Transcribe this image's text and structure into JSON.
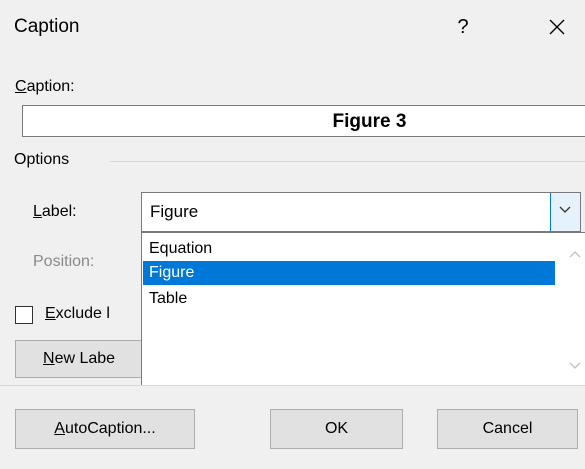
{
  "window": {
    "title": "Caption",
    "help_label": "?",
    "close_icon": "close-icon"
  },
  "caption": {
    "label_first": "C",
    "label_rest": "aption:",
    "value": "Figure 3"
  },
  "options": {
    "group_label": "Options",
    "label_field": {
      "label_first": "L",
      "label_rest": "abel:",
      "value": "Figure"
    },
    "position_field": {
      "label": "Position:"
    },
    "dropdown_items": [
      {
        "label": "Equation",
        "selected": false
      },
      {
        "label": "Figure",
        "selected": true
      },
      {
        "label": "Table",
        "selected": false
      }
    ]
  },
  "exclude": {
    "label_first": "E",
    "label_rest": "xclude l",
    "checked": false
  },
  "new_label_button": {
    "label_first": "N",
    "label_rest": "ew Labe"
  },
  "buttons": {
    "autocaption_first": "A",
    "autocaption_rest": "utoCaption...",
    "ok": "OK",
    "cancel": "Cancel"
  },
  "colors": {
    "selection": "#0078d7",
    "dialog_bg": "#f0f0f0",
    "button_bg": "#e1e1e1"
  }
}
